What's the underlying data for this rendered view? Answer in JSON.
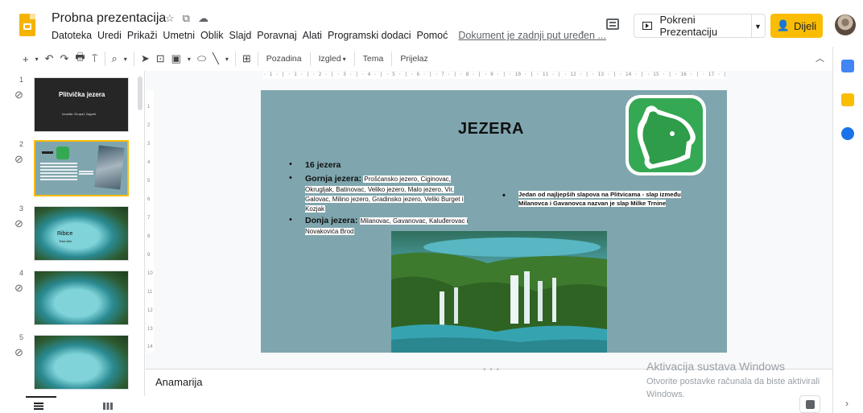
{
  "header": {
    "doc_title": "Probna prezentacija",
    "menu": [
      "Datoteka",
      "Uredi",
      "Prikaži",
      "Umetni",
      "Oblik",
      "Slajd",
      "Poravnaj",
      "Alati",
      "Programski dodaci",
      "Pomoć"
    ],
    "last_edit": "Dokument je zadnji put uređen ...",
    "present_label": "Pokreni Prezentaciju",
    "share_label": "Dijeli"
  },
  "toolbar": {
    "background_label": "Pozadina",
    "layout_label": "Izgled",
    "theme_label": "Tema",
    "transition_label": "Prijelaz"
  },
  "ruler": {
    "h_text": "· 1 · | · 1 · | · 2 · | · 3 · | · 4 · | · 5 · | · 6 · | · 7 · | · 8 · | · 9 · | · 10 · | · 11 · | · 12 · | · 13 · | · 14 · | · 15 · | · 16 · | · 17 · | · 18 · | · 19 · | · 20 · | · 21 · | · 22 · | · 23 · | · 24 · | · 25 ·",
    "v_marks": [
      "1",
      "2",
      "3",
      "4",
      "5",
      "6",
      "7",
      "8",
      "9",
      "10",
      "11",
      "12",
      "13",
      "14"
    ]
  },
  "filmstrip": {
    "slides": [
      {
        "number": "1",
        "title": "Plitvička jezera",
        "subtitle": "Izradila: Grupa1 Zagreb"
      },
      {
        "number": "2"
      },
      {
        "number": "3",
        "title": "Ribice",
        "subtitle": "Tekst slike"
      },
      {
        "number": "4"
      },
      {
        "number": "5"
      }
    ]
  },
  "slide": {
    "title": "JEZERA",
    "bullets": [
      {
        "head": "16 jezera",
        "text": ""
      },
      {
        "head": "Gornja jezera:",
        "text": "Prošćansko jezero, Ciginovac, Okrugljak, Batinovac, Veliko jezero, Malo jezero, Vir, Galovac, Milino jezero, Gradinsko jezero, Veliki Burget i Kozjak"
      },
      {
        "head": "Donja jezera:",
        "text": "Milanovac, Gavanovac, Kaluđerovac i Novakovića Brod"
      }
    ],
    "right_bullet": "Jedan od najljepših slapova na Plitvicama - slap između Milanovca i Gavanovca nazvan je slap Milke Trnine"
  },
  "notes": {
    "text": "Anamarija"
  },
  "watermark": {
    "line1": "Aktivacija sustava Windows",
    "line2": "Otvorite postavke računala da biste aktivirali Windows."
  },
  "colors": {
    "slide_bg": "#7fa6ae",
    "accent_yellow": "#fbbc04",
    "logo_green": "#34a853"
  }
}
